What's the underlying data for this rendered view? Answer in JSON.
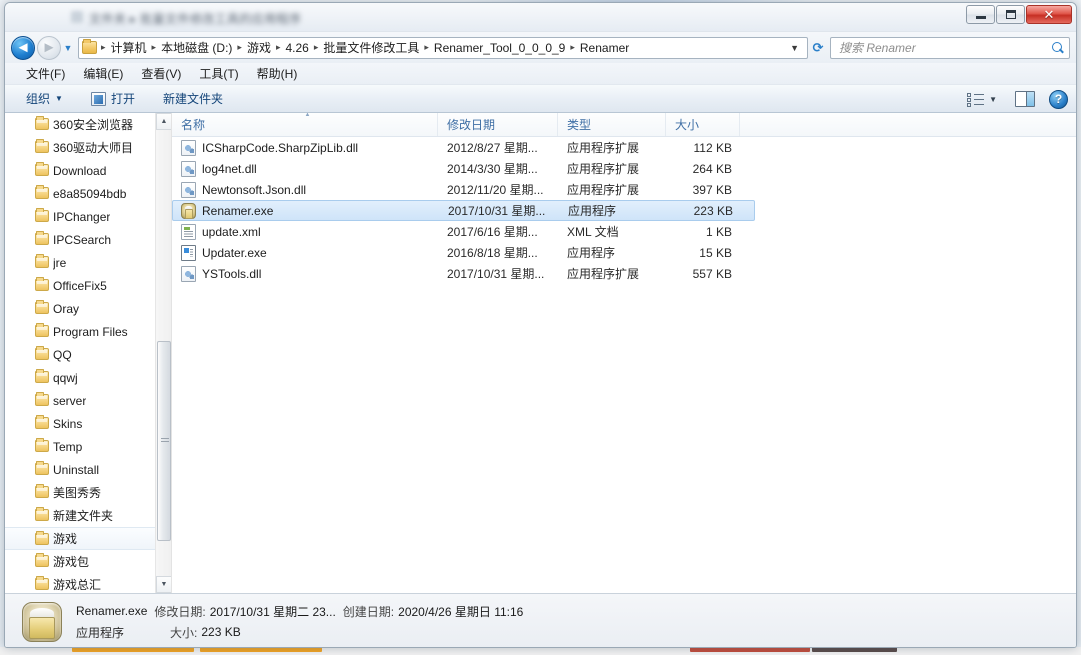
{
  "window": {
    "title_blurred": "文件夹 ▸ 批量文件修改工具的应用程序",
    "controls": {
      "minimize": "最小化",
      "maximize": "最大化",
      "close": "✕"
    }
  },
  "nav": {
    "back": "◄",
    "forward": "►",
    "recent_caret": "▼",
    "refresh_icon": "refresh-icon"
  },
  "breadcrumb": {
    "separator": "▸",
    "caret": "▼",
    "items": [
      "计算机",
      "本地磁盘 (D:)",
      "游戏",
      "4.26",
      "批量文件修改工具",
      "Renamer_Tool_0_0_0_9",
      "Renamer"
    ]
  },
  "search": {
    "placeholder": "搜索 Renamer",
    "value": ""
  },
  "menubar": {
    "items": [
      "文件(F)",
      "编辑(E)",
      "查看(V)",
      "工具(T)",
      "帮助(H)"
    ]
  },
  "toolbar": {
    "organize": "组织",
    "organize_caret": "▼",
    "open": "打开",
    "new_folder": "新建文件夹",
    "view_caret": "▼"
  },
  "sidebar": {
    "items": [
      {
        "label": "360安全浏览器",
        "selected": false
      },
      {
        "label": "360驱动大师目",
        "selected": false
      },
      {
        "label": "Download",
        "selected": false
      },
      {
        "label": "e8a85094bdb",
        "selected": false
      },
      {
        "label": "IPChanger",
        "selected": false
      },
      {
        "label": "IPCSearch",
        "selected": false
      },
      {
        "label": "jre",
        "selected": false
      },
      {
        "label": "OfficeFix5",
        "selected": false
      },
      {
        "label": "Oray",
        "selected": false
      },
      {
        "label": "Program Files",
        "selected": false
      },
      {
        "label": "QQ",
        "selected": false
      },
      {
        "label": "qqwj",
        "selected": false
      },
      {
        "label": "server",
        "selected": false
      },
      {
        "label": "Skins",
        "selected": false
      },
      {
        "label": "Temp",
        "selected": false
      },
      {
        "label": "Uninstall",
        "selected": false
      },
      {
        "label": "美图秀秀",
        "selected": false
      },
      {
        "label": "新建文件夹",
        "selected": false
      },
      {
        "label": "游戏",
        "selected": true
      },
      {
        "label": "游戏包",
        "selected": false
      },
      {
        "label": "游戏总汇",
        "selected": false
      }
    ]
  },
  "filelist": {
    "columns": [
      {
        "key": "name",
        "label": "名称",
        "sorted": true
      },
      {
        "key": "date",
        "label": "修改日期",
        "sorted": false
      },
      {
        "key": "type",
        "label": "类型",
        "sorted": false
      },
      {
        "key": "size",
        "label": "大小",
        "sorted": false
      }
    ],
    "rows": [
      {
        "icon": "dll",
        "name": "ICSharpCode.SharpZipLib.dll",
        "date": "2012/8/27 星期...",
        "type": "应用程序扩展",
        "size": "112 KB",
        "selected": false
      },
      {
        "icon": "dll",
        "name": "log4net.dll",
        "date": "2014/3/30 星期...",
        "type": "应用程序扩展",
        "size": "264 KB",
        "selected": false
      },
      {
        "icon": "dll",
        "name": "Newtonsoft.Json.dll",
        "date": "2012/11/20 星期...",
        "type": "应用程序扩展",
        "size": "397 KB",
        "selected": false
      },
      {
        "icon": "renamer",
        "name": "Renamer.exe",
        "date": "2017/10/31 星期...",
        "type": "应用程序",
        "size": "223 KB",
        "selected": true
      },
      {
        "icon": "xml",
        "name": "update.xml",
        "date": "2017/6/16 星期...",
        "type": "XML 文档",
        "size": "1 KB",
        "selected": false
      },
      {
        "icon": "updater",
        "name": "Updater.exe",
        "date": "2016/8/18 星期...",
        "type": "应用程序",
        "size": "15 KB",
        "selected": false
      },
      {
        "icon": "dll",
        "name": "YSTools.dll",
        "date": "2017/10/31 星期...",
        "type": "应用程序扩展",
        "size": "557 KB",
        "selected": false
      }
    ]
  },
  "status": {
    "filename": "Renamer.exe",
    "modified_label": "修改日期:",
    "modified_value": "2017/10/31 星期二 23...",
    "created_label": "创建日期:",
    "created_value": "2020/4/26 星期日 11:16",
    "filetype": "应用程序",
    "size_label": "大小:",
    "size_value": "223 KB"
  },
  "colors": {
    "accent": "#2a7fc9",
    "selection": "#cfe4f9",
    "selection_border": "#a9cced",
    "column_header_text": "#3f6fa5",
    "folder": "#f3c969",
    "close_button": "#c62f24"
  }
}
